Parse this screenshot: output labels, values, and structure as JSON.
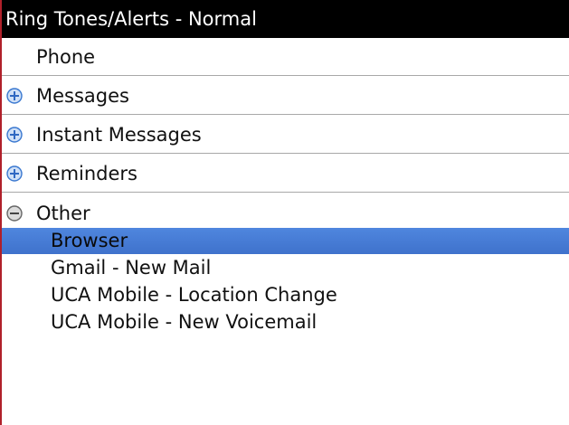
{
  "title": "Ring Tones/Alerts - Normal",
  "groups": [
    {
      "label": "Phone",
      "expander": "none"
    },
    {
      "label": "Messages",
      "expander": "plus-icon"
    },
    {
      "label": "Instant Messages",
      "expander": "plus-icon"
    },
    {
      "label": "Reminders",
      "expander": "plus-icon"
    },
    {
      "label": "Other",
      "expander": "minus-icon"
    }
  ],
  "other_items": [
    {
      "label": "Browser",
      "selected": true
    },
    {
      "label": "Gmail - New Mail",
      "selected": false
    },
    {
      "label": "UCA Mobile - Location Change",
      "selected": false
    },
    {
      "label": "UCA Mobile - New Voicemail",
      "selected": false
    }
  ],
  "colors": {
    "titlebar_bg": "#000000",
    "selection": "#4a7fd8",
    "expander_fill": "#4a8fe0",
    "divider": "#a8a8a8",
    "left_edge": "#b0202a"
  }
}
